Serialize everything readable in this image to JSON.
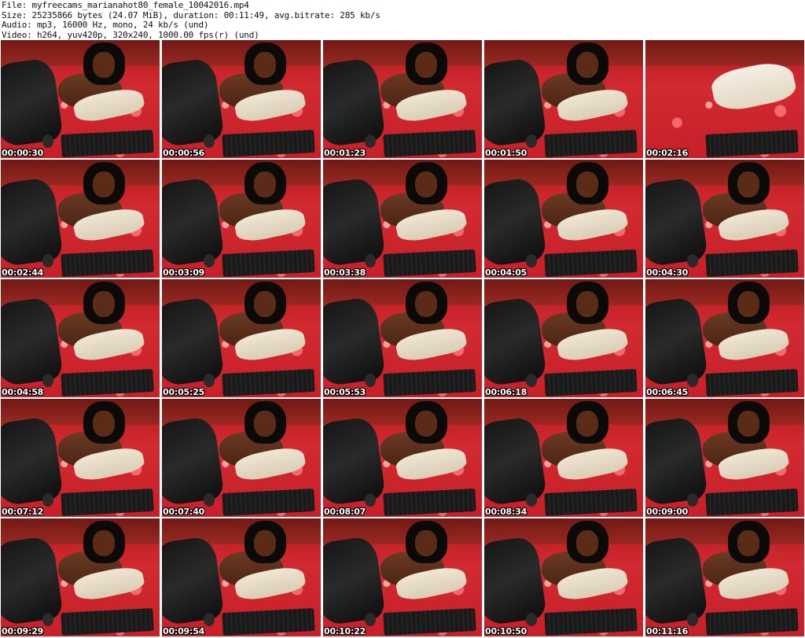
{
  "header": {
    "file": "File: myfreecams_marianahot80_female_10042016.mp4",
    "size": "Size: 25235866 bytes (24.07 MiB), duration: 00:11:49, avg.bitrate: 285 kb/s",
    "audio": "Audio: mp3, 16000 Hz, mono, 24 kb/s (und)",
    "video": "Video: h264, yuv420p, 320x240, 1000.00 fps(r) (und)"
  },
  "thumbnails": [
    {
      "timestamp": "00:00:30"
    },
    {
      "timestamp": "00:00:56"
    },
    {
      "timestamp": "00:01:23"
    },
    {
      "timestamp": "00:01:50"
    },
    {
      "timestamp": "00:02:16"
    },
    {
      "timestamp": "00:02:44"
    },
    {
      "timestamp": "00:03:09"
    },
    {
      "timestamp": "00:03:38"
    },
    {
      "timestamp": "00:04:05"
    },
    {
      "timestamp": "00:04:30"
    },
    {
      "timestamp": "00:04:58"
    },
    {
      "timestamp": "00:05:25"
    },
    {
      "timestamp": "00:05:53"
    },
    {
      "timestamp": "00:06:18"
    },
    {
      "timestamp": "00:06:45"
    },
    {
      "timestamp": "00:07:12"
    },
    {
      "timestamp": "00:07:40"
    },
    {
      "timestamp": "00:08:07"
    },
    {
      "timestamp": "00:08:34"
    },
    {
      "timestamp": "00:09:00"
    },
    {
      "timestamp": "00:09:29"
    },
    {
      "timestamp": "00:09:54"
    },
    {
      "timestamp": "00:10:22"
    },
    {
      "timestamp": "00:10:50"
    },
    {
      "timestamp": "00:11:16"
    }
  ]
}
